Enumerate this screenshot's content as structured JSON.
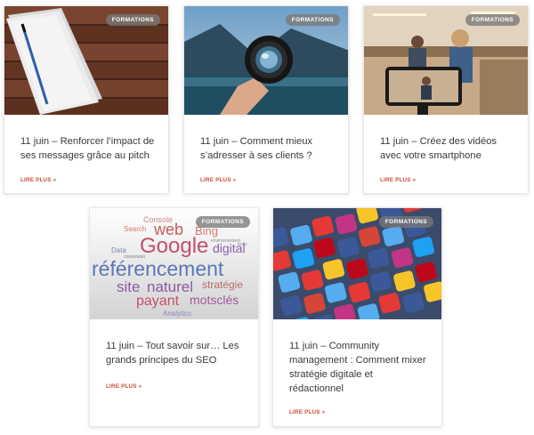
{
  "cards": [
    {
      "badge": "FORMATIONS",
      "title": "11 juin – Renforcer l’impact de ses messages grâce au pitch",
      "read_more": "LIRE PLUS »"
    },
    {
      "badge": "FORMATIONS",
      "title": "11 juin – Comment mieux s’adresser à ses clients ?",
      "read_more": "LIRE PLUS »"
    },
    {
      "badge": "FORMATIONS",
      "title": "11 juin – Créez des vidéos avec votre smartphone",
      "read_more": "LIRE PLUS »"
    },
    {
      "badge": "FORMATIONS",
      "title": "11 juin – Tout savoir sur… Les grands principes du SEO",
      "read_more": "LIRE PLUS »",
      "word_cloud": [
        "Console",
        "Search",
        "web",
        "Bing",
        "Google",
        "Data",
        "digital",
        "référencement",
        "site",
        "naturel",
        "stratégie",
        "payant",
        "motsclés",
        "Analytics",
        "conversion",
        "trafic",
        "environnement"
      ]
    },
    {
      "badge": "FORMATIONS",
      "title": "11 juin – Community management : Comment mixer stratégie digitale et rédactionnel",
      "read_more": "LIRE PLUS »"
    }
  ],
  "colors": {
    "badge_bg": "#7a7a7a",
    "read_more": "#c94c3a",
    "title": "#3a3a3a"
  }
}
